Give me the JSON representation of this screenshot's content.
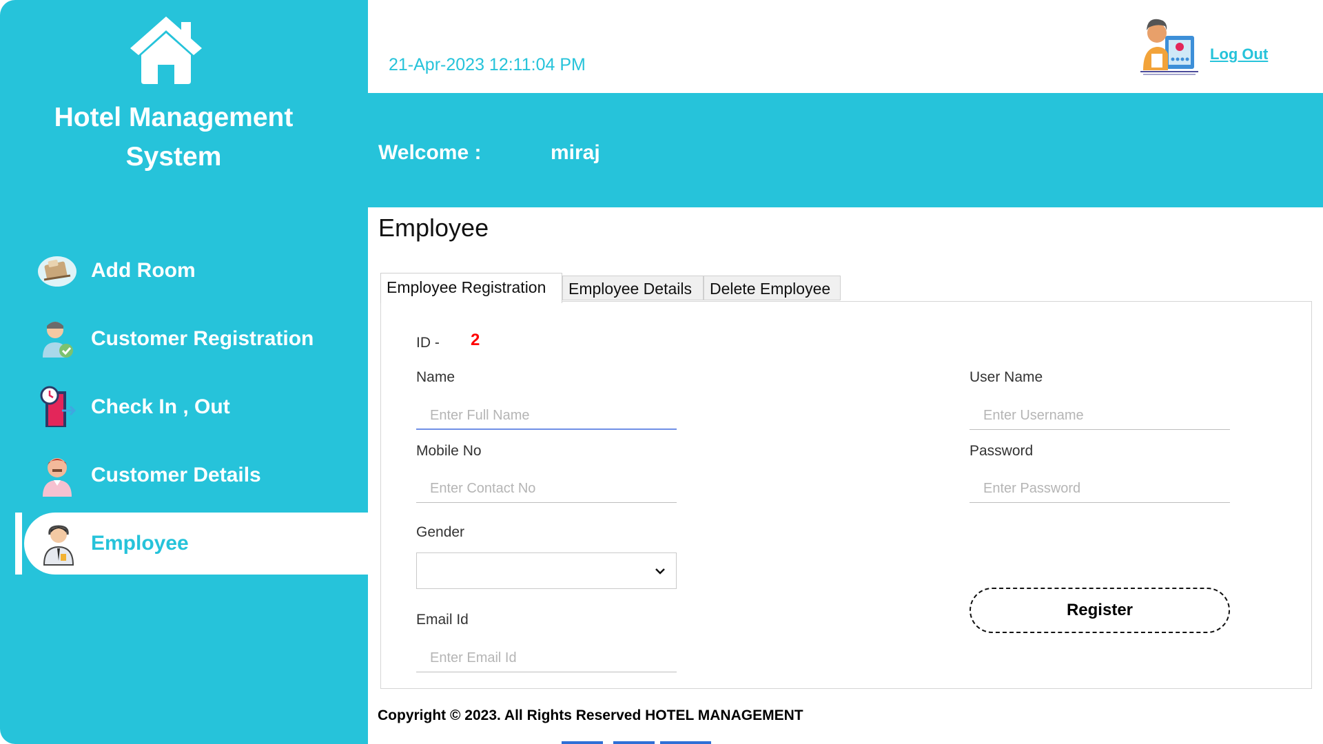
{
  "app": {
    "title": "Hotel Management System",
    "title_line1": "Hotel Management",
    "title_line2": "System"
  },
  "sidebar": {
    "items": [
      {
        "label": "Add Room",
        "icon": "bed-icon",
        "active": false
      },
      {
        "label": "Customer Registration",
        "icon": "customer-registration-icon",
        "active": false
      },
      {
        "label": "Check In , Out",
        "icon": "check-in-out-door-icon",
        "active": false
      },
      {
        "label": "Customer Details",
        "icon": "customer-details-icon",
        "active": false
      },
      {
        "label": "Employee",
        "icon": "employee-icon",
        "active": true
      }
    ]
  },
  "header": {
    "datetime": "21-Apr-2023 12:11:04 PM",
    "logout_label": "Log Out",
    "welcome_label": "Welcome :",
    "username": "miraj"
  },
  "main": {
    "page_title": "Employee",
    "tabs": [
      {
        "label": "Employee Registration",
        "active": true
      },
      {
        "label": "Employee Details",
        "active": false
      },
      {
        "label": "Delete Employee",
        "active": false
      }
    ],
    "form": {
      "id_label": "ID  -",
      "id_value": "2",
      "name_label": "Name",
      "name_placeholder": "Enter Full Name",
      "mobile_label": "Mobile No",
      "mobile_placeholder": "Enter Contact No",
      "gender_label": "Gender",
      "gender_value": "",
      "email_label": "Email Id",
      "email_placeholder": "Enter Email Id",
      "username_label": "User Name",
      "username_placeholder": "Enter Username",
      "password_label": "Password",
      "password_placeholder": "Enter Password",
      "register_label": "Register"
    }
  },
  "footer": {
    "copyright": "Copyright © 2023. All Rights Reserved HOTEL MANAGEMENT"
  },
  "colors": {
    "accent": "#26c3da",
    "id_value": "#ff0000",
    "focus_underline": "#6f8fe6"
  }
}
